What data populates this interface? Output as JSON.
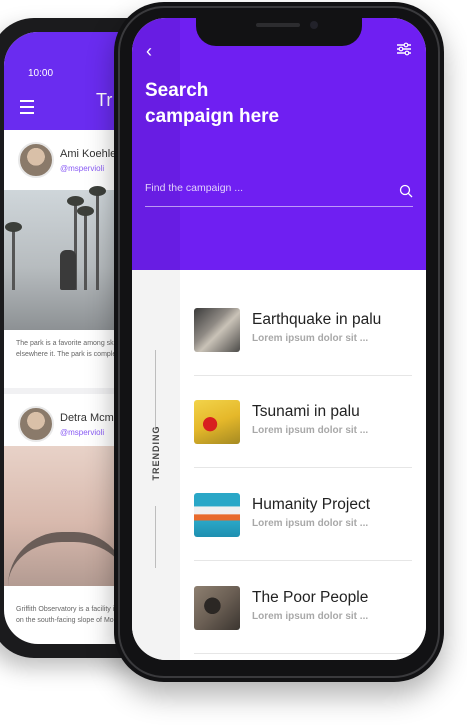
{
  "back_screen": {
    "status_time": "10:00",
    "title": "Tr",
    "posts": [
      {
        "author": "Ami Koehler",
        "handle": "@mspervioli",
        "caption": "The park is a favorite among skat... elsewhere it. The park is complete"
      },
      {
        "author": "Detra Mcmunn",
        "handle": "@mspervioli",
        "caption": "Griffith Observatory is a facility in ... on the south-facing slope of Moun"
      }
    ]
  },
  "screen": {
    "title": "Search\ncampaign here",
    "search": {
      "placeholder": "Find the campaign ..."
    },
    "side_label": "TRENDING",
    "campaigns": [
      {
        "title": "Earthquake in palu",
        "subtitle": "Lorem ipsum dolor sit ..."
      },
      {
        "title": "Tsunami in palu",
        "subtitle": "Lorem ipsum dolor sit ..."
      },
      {
        "title": "Humanity Project",
        "subtitle": "Lorem ipsum dolor sit ..."
      },
      {
        "title": "The Poor People",
        "subtitle": "Lorem ipsum dolor sit ..."
      }
    ]
  },
  "colors": {
    "primary": "#6f1ff2",
    "back_primary": "#6a2cf0"
  },
  "icons": {
    "back": "chevron-left-icon",
    "filter": "sliders-icon",
    "search": "search-icon",
    "menu": "menu-icon"
  }
}
